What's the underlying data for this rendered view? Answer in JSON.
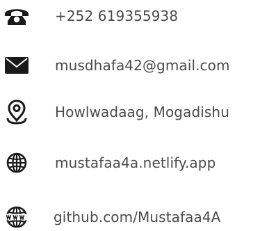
{
  "contacts": [
    {
      "icon": "phone-icon",
      "text": "+252 619355938"
    },
    {
      "icon": "envelope-icon",
      "text": "musdhafa42@gmail.com"
    },
    {
      "icon": "location-pin-icon",
      "text": "Howlwadaag, Mogadishu"
    },
    {
      "icon": "globe-icon",
      "text": "mustafaa4a.netlify.app"
    },
    {
      "icon": "globe-www-icon",
      "text": "github.com/Mustafaa4A"
    }
  ],
  "colors": {
    "icon": "#1a1a1a",
    "text": "#4a4a4a",
    "background": "#ffffff"
  }
}
